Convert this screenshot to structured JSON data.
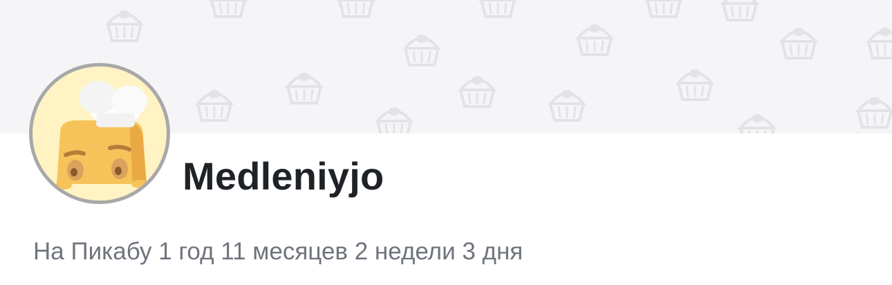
{
  "profile": {
    "username": "Medleniyjo",
    "tenure_text": "На Пикабу 1 год 11 месяцев 2 недели 3 дня",
    "avatar_icon": "chef-toast-avatar-icon",
    "cover_pattern_icon": "cupcake-pattern-icon"
  },
  "colors": {
    "cover_bg": "#f5f5f7",
    "pattern": "#e3e3e6",
    "avatar_border": "#a8a8a8",
    "avatar_bg": "#fff3c4",
    "username": "#1f2328",
    "tenure": "#6f747c"
  }
}
